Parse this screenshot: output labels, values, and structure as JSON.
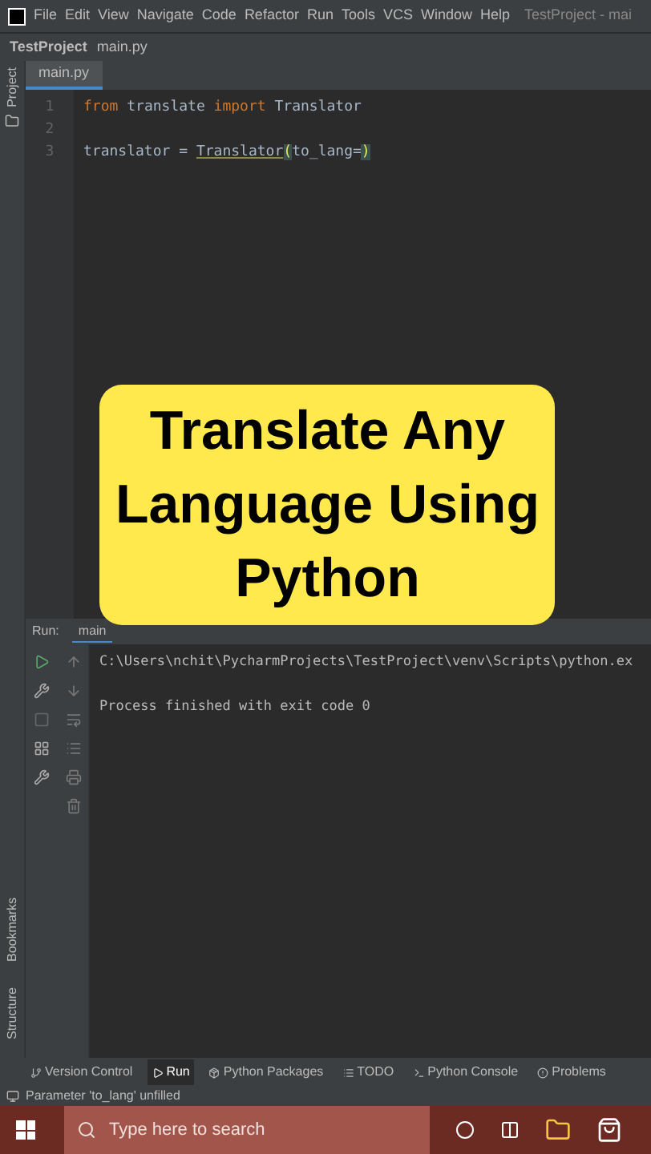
{
  "menu": {
    "items": [
      "File",
      "Edit",
      "View",
      "Navigate",
      "Code",
      "Refactor",
      "Run",
      "Tools",
      "VCS",
      "Window",
      "Help"
    ],
    "title": "TestProject - mai"
  },
  "breadcrumb": [
    "TestProject",
    "main.py"
  ],
  "editor_tabs": [
    {
      "label": "main.py",
      "selected": true
    }
  ],
  "side_labels": [
    "Project"
  ],
  "code": [
    {
      "number": "1",
      "tokens": [
        {
          "kind": "keyword",
          "text": "from"
        },
        {
          "kind": "plain",
          "text": " translate "
        },
        {
          "kind": "keyword",
          "text": "import"
        },
        {
          "kind": "plain",
          "text": " Translator"
        }
      ]
    },
    {
      "number": "2"
    },
    {
      "number": "3",
      "tokens": [
        {
          "kind": "plain",
          "text": "translator = "
        },
        {
          "kind": "class",
          "text": "Translator"
        },
        {
          "kind": "paren",
          "text": "("
        },
        {
          "kind": "plain",
          "text": "to_lang="
        },
        {
          "kind": "paren",
          "text": ")"
        }
      ]
    }
  ],
  "caption": [
    "Translate Any",
    "Language Using",
    "Python"
  ],
  "run": {
    "label": "Run:",
    "tab": "main",
    "command": "C:\\Users\\nchit\\PycharmProjects\\TestProject\\venv\\Scripts\\python.ex",
    "result": "Process finished with exit code 0"
  },
  "left_bottom_labels": [
    "Bookmarks",
    "Structure"
  ],
  "tool_tabs": [
    {
      "label": "Version Control",
      "selected": false
    },
    {
      "label": "Run",
      "selected": true
    },
    {
      "label": "Python Packages",
      "selected": false
    },
    {
      "label": "TODO",
      "selected": false
    },
    {
      "label": "Python Console",
      "selected": false
    },
    {
      "label": "Problems",
      "selected": false
    }
  ],
  "status": "Parameter 'to_lang' unfilled",
  "taskbar": {
    "search_placeholder": "Type here to search"
  }
}
